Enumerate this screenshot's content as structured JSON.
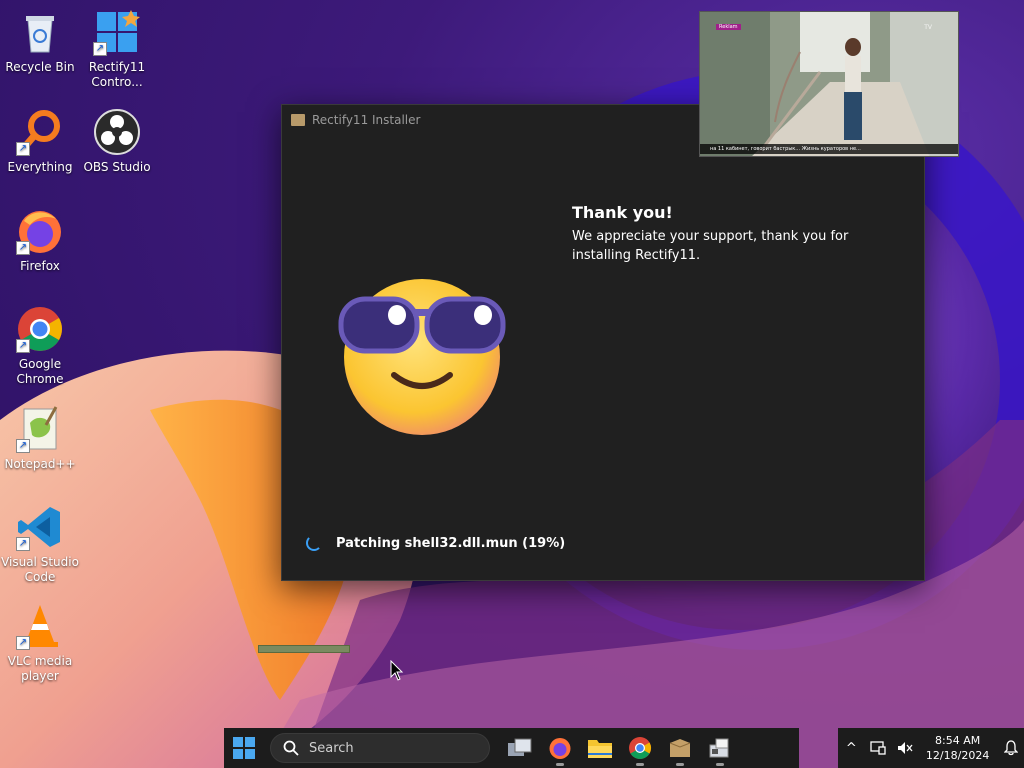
{
  "desktop": {
    "icons": [
      {
        "label": "Recycle Bin"
      },
      {
        "label": "Rectify11 Contro..."
      },
      {
        "label": "Everything"
      },
      {
        "label": "OBS Studio"
      },
      {
        "label": "Firefox"
      },
      {
        "label": "Google Chrome"
      },
      {
        "label": "Notepad++"
      },
      {
        "label": "Visual Studio Code"
      },
      {
        "label": "VLC media player"
      }
    ]
  },
  "installer": {
    "title": "Rectify11 Installer",
    "heading": "Thank you!",
    "message": "We appreciate your support, thank you for installing Rectify11.",
    "status": "Patching shell32.dll.mun (19%)",
    "progress_percent": 19
  },
  "video": {
    "ticker": "на 11 кабинет, говорит бастрык... Жизнь кураторов не...",
    "badge": "Reklam",
    "channel": "TV"
  },
  "taskbar": {
    "search_placeholder": "Search",
    "apps": [
      "task-view",
      "firefox",
      "file-explorer",
      "chrome",
      "rectify11-installer",
      "app-installer"
    ]
  },
  "tray": {
    "time": "8:54 AM",
    "date": "12/18/2024"
  },
  "colors": {
    "accent": "#3a9ff5",
    "window_bg": "#202020",
    "taskbar_bg": "#1c1c1c"
  }
}
